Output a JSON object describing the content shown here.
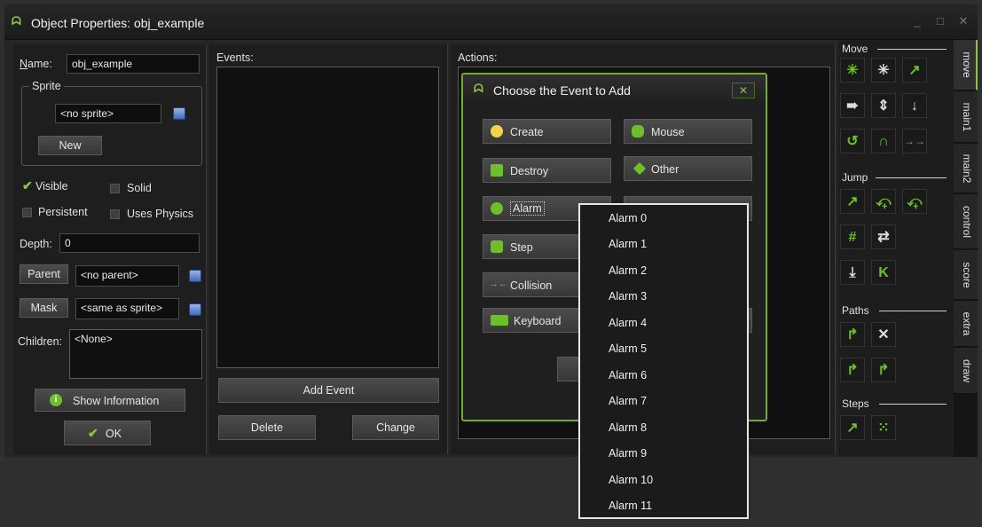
{
  "window": {
    "title": "Object Properties: obj_example",
    "controls": [
      "_",
      "□",
      "✕"
    ]
  },
  "left": {
    "name_label": "Name:",
    "name_value": "obj_example",
    "sprite_group": "Sprite",
    "sprite_value": "<no sprite>",
    "new_button": "New",
    "visible_label": "Visible",
    "visible_checked": true,
    "solid_label": "Solid",
    "persistent_label": "Persistent",
    "uses_physics_label": "Uses Physics",
    "depth_label": "Depth:",
    "depth_value": "0",
    "parent_button": "Parent",
    "parent_value": "<no parent>",
    "mask_button": "Mask",
    "mask_value": "<same as sprite>",
    "children_label": "Children:",
    "children_value": "<None>",
    "show_info_button": "Show Information",
    "ok_button": "OK"
  },
  "events": {
    "label": "Events:",
    "add_event_button": "Add Event",
    "delete_button": "Delete",
    "change_button": "Change"
  },
  "actions": {
    "label": "Actions:"
  },
  "dialog": {
    "title": "Choose the Event to Add",
    "close": "✕",
    "buttons": {
      "create": "Create",
      "mouse": "Mouse",
      "destroy": "Destroy",
      "other": "Other",
      "alarm": "Alarm",
      "step": "Step",
      "collision": "Collision",
      "keyboard": "Keyboard"
    }
  },
  "alarm_menu": {
    "items": [
      "Alarm 0",
      "Alarm 1",
      "Alarm 2",
      "Alarm 3",
      "Alarm 4",
      "Alarm 5",
      "Alarm 6",
      "Alarm 7",
      "Alarm 8",
      "Alarm 9",
      "Alarm 10",
      "Alarm 11"
    ]
  },
  "side": {
    "sections": {
      "move": "Move",
      "jump": "Jump",
      "paths": "Paths",
      "steps": "Steps"
    },
    "tabs": [
      "move",
      "main1",
      "main2",
      "control",
      "score",
      "extra",
      "draw"
    ],
    "accent": "#8cc63f"
  }
}
